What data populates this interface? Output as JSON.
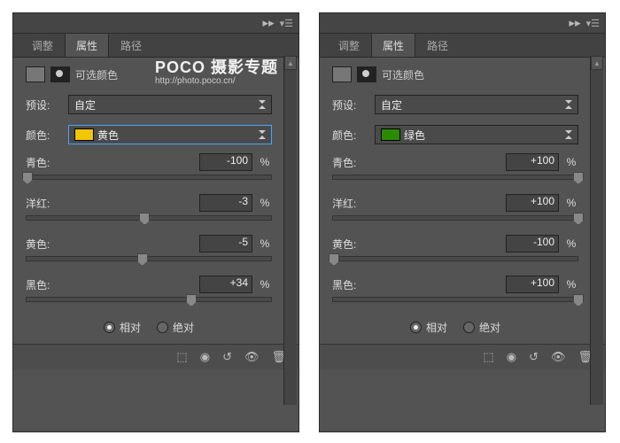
{
  "watermark": {
    "t1": "POCO 摄影专题",
    "t2": "http://photo.poco.cn/"
  },
  "tabs": {
    "adjust": "调整",
    "props": "属性",
    "path": "路径"
  },
  "title": "可选颜色",
  "preset": {
    "label": "预设:",
    "value": "自定"
  },
  "color": {
    "label": "颜色:"
  },
  "sliders": {
    "cyan": "青色:",
    "magenta": "洋红:",
    "yellow": "黄色:",
    "black": "黑色:",
    "pct": "%"
  },
  "mode": {
    "rel": "相对",
    "abs": "绝对"
  },
  "left": {
    "color": {
      "value": "黄色",
      "swatch": "#f2c600"
    },
    "cyan": {
      "value": "-100",
      "pos": 0
    },
    "magenta": {
      "value": "-3",
      "pos": 48
    },
    "yellow": {
      "value": "-5",
      "pos": 47
    },
    "black": {
      "value": "+34",
      "pos": 67
    }
  },
  "right": {
    "color": {
      "value": "绿色",
      "swatch": "#2a8a00"
    },
    "cyan": {
      "value": "+100",
      "pos": 100
    },
    "magenta": {
      "value": "+100",
      "pos": 100
    },
    "yellow": {
      "value": "-100",
      "pos": 0
    },
    "black": {
      "value": "+100",
      "pos": 100
    }
  }
}
